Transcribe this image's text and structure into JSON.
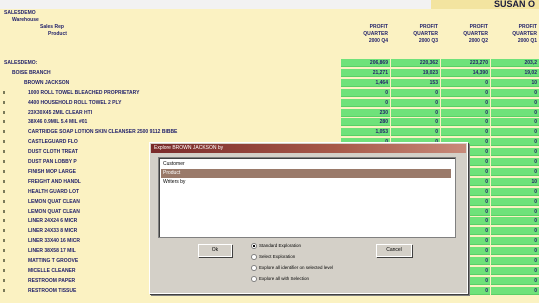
{
  "report": {
    "title": "SUSAN O"
  },
  "headers": {
    "rows": [
      "SALESDEMO",
      "Warehouse",
      "Sales Rep",
      "Product"
    ],
    "columns": [
      [
        "PROFIT",
        "QUARTER",
        "2000 Q4"
      ],
      [
        "PROFIT",
        "QUARTER",
        "2000 Q3"
      ],
      [
        "PROFIT",
        "QUARTER",
        "2000 Q2"
      ],
      [
        "PROFIT",
        "QUARTER",
        "2000 Q1"
      ]
    ]
  },
  "rows": [
    {
      "label": "SALESDEMO:",
      "indent": 0,
      "values": [
        "206,869",
        "220,362",
        "223,270",
        "203,2"
      ]
    },
    {
      "label": "BOISE BRANCH",
      "indent": 1,
      "values": [
        "21,271",
        "19,023",
        "14,390",
        "19,02"
      ]
    },
    {
      "label": "BROWN JACKSON",
      "indent": 2,
      "values": [
        "1,464",
        "153",
        "0",
        "10"
      ]
    },
    {
      "label": "1000 ROLL TOWEL BLEACHED PROPRIETARY",
      "indent": 3,
      "values": [
        "0",
        "0",
        "0",
        "0"
      ]
    },
    {
      "label": "4400 HOUSEHOLD ROLL TOWEL 2 PLY",
      "indent": 3,
      "values": [
        "0",
        "0",
        "0",
        "0"
      ]
    },
    {
      "label": "23X30X45 2MIL CLEAR HTI",
      "indent": 3,
      "values": [
        "230",
        "0",
        "0",
        "0"
      ]
    },
    {
      "label": "38X46 0.9MIL 5.4 MIL #01",
      "indent": 3,
      "values": [
        "280",
        "0",
        "0",
        "0"
      ]
    },
    {
      "label": "CARTRIDGE SOAP LOTION SKIN CLEANSER 2500 9112 BIBBE",
      "indent": 3,
      "values": [
        "1,053",
        "0",
        "0",
        "0"
      ]
    },
    {
      "label": "CASTLEGUARD FLO",
      "indent": 3,
      "values": [
        "0",
        "0",
        "0",
        "0"
      ]
    },
    {
      "label": "DUST CLOTH TREAT",
      "indent": 3,
      "values": [
        "0",
        "0",
        "0",
        "0"
      ]
    },
    {
      "label": "DUST PAN LOBBY P",
      "indent": 3,
      "values": [
        "0",
        "0",
        "0",
        "0"
      ]
    },
    {
      "label": "FINISH MOP LARGE",
      "indent": 3,
      "values": [
        "0",
        "0",
        "0",
        "0"
      ]
    },
    {
      "label": "FREIGHT AND HANDL",
      "indent": 3,
      "values": [
        "0",
        "0",
        "0",
        "10"
      ]
    },
    {
      "label": "HEALTH GUARD LOT",
      "indent": 3,
      "values": [
        "0",
        "0",
        "0",
        "0"
      ]
    },
    {
      "label": "LEMON QUAT CLEAN",
      "indent": 3,
      "values": [
        "0",
        "0",
        "0",
        "0"
      ]
    },
    {
      "label": "LEMON QUAT CLEAN",
      "indent": 3,
      "values": [
        "0",
        "0",
        "0",
        "0"
      ]
    },
    {
      "label": "LINER 24X24 6 MICR",
      "indent": 3,
      "values": [
        "0",
        "0",
        "0",
        "0"
      ]
    },
    {
      "label": "LINER 24X33 8 MICR",
      "indent": 3,
      "values": [
        "0",
        "0",
        "0",
        "0"
      ]
    },
    {
      "label": "LINER 33X40 16 MICR",
      "indent": 3,
      "values": [
        "0",
        "0",
        "0",
        "0"
      ]
    },
    {
      "label": "LINER 38X58 17 MIL",
      "indent": 3,
      "values": [
        "0",
        "0",
        "0",
        "0"
      ]
    },
    {
      "label": "MATTING T GROOVE",
      "indent": 3,
      "values": [
        "0",
        "0",
        "0",
        "0"
      ]
    },
    {
      "label": "MICELLE CLEANER",
      "indent": 3,
      "values": [
        "0",
        "0",
        "0",
        "0"
      ]
    },
    {
      "label": "RESTROOM PAPER",
      "indent": 3,
      "values": [
        "0",
        "0",
        "0",
        "0"
      ]
    },
    {
      "label": "RESTROOM TISSUE",
      "indent": 3,
      "values": [
        "0",
        "0",
        "0",
        "0"
      ]
    }
  ],
  "dialog": {
    "title": "Explore BROWN JACKSON by",
    "list_items": [
      "Customer",
      "Product",
      "Writers by"
    ],
    "selected_index": 1,
    "ok_label": "Ok",
    "cancel_label": "Cancel",
    "options": [
      {
        "label": "Standard Exploration",
        "checked": true
      },
      {
        "label": "Select Exploration",
        "checked": false
      },
      {
        "label": "Explore all identifier on selected level",
        "checked": false
      },
      {
        "label": "Explore all with Selection",
        "checked": false
      }
    ]
  },
  "colors": {
    "sheet_bg": "#fbf2c2",
    "value_cell": "#6fe27a",
    "text": "#23236b"
  }
}
